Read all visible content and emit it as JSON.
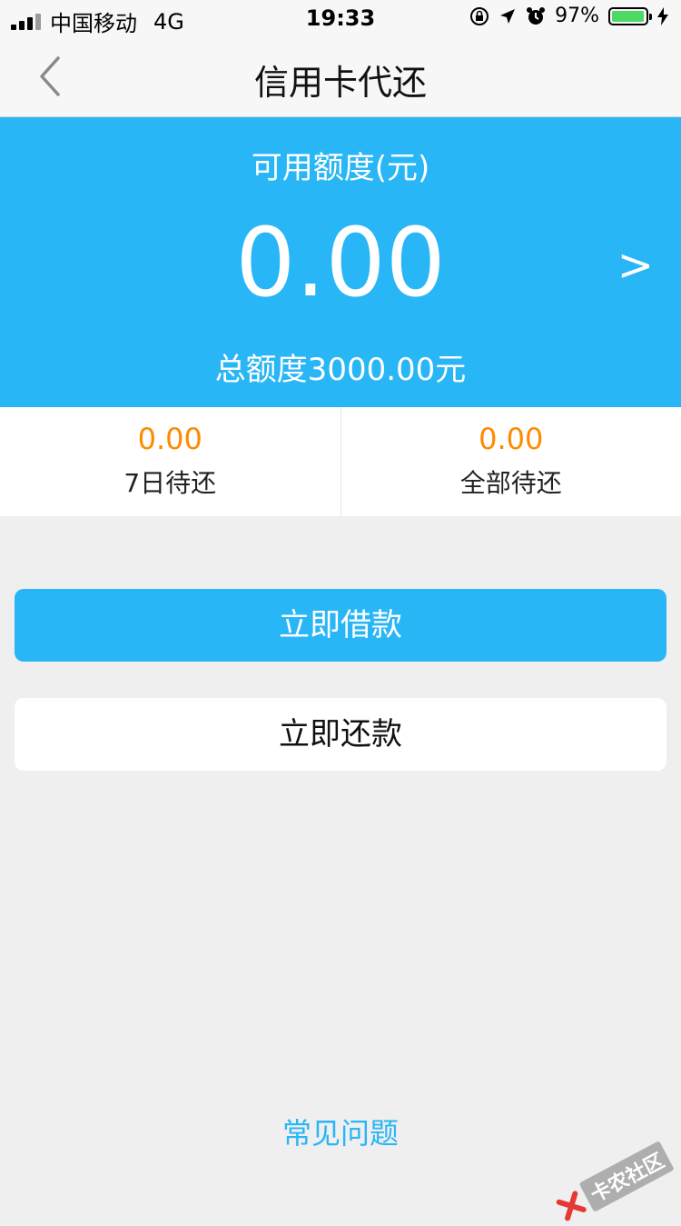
{
  "status_bar": {
    "carrier": "中国移动",
    "network": "4G",
    "time": "19:33",
    "battery_percent": "97%",
    "battery_level": 0.97
  },
  "nav": {
    "title": "信用卡代还"
  },
  "hero": {
    "available_label": "可用额度(元)",
    "available_amount": "0.00",
    "arrow": ">",
    "total_limit": "总额度3000.00元"
  },
  "stats": [
    {
      "value": "0.00",
      "label": "7日待还"
    },
    {
      "value": "0.00",
      "label": "全部待还"
    }
  ],
  "actions": {
    "borrow_label": "立即借款",
    "repay_label": "立即还款"
  },
  "footer": {
    "faq_label": "常见问题",
    "watermark": "卡农社区"
  },
  "colors": {
    "accent": "#29b6f6",
    "stat_value": "#ff8a00",
    "background": "#efefef"
  }
}
